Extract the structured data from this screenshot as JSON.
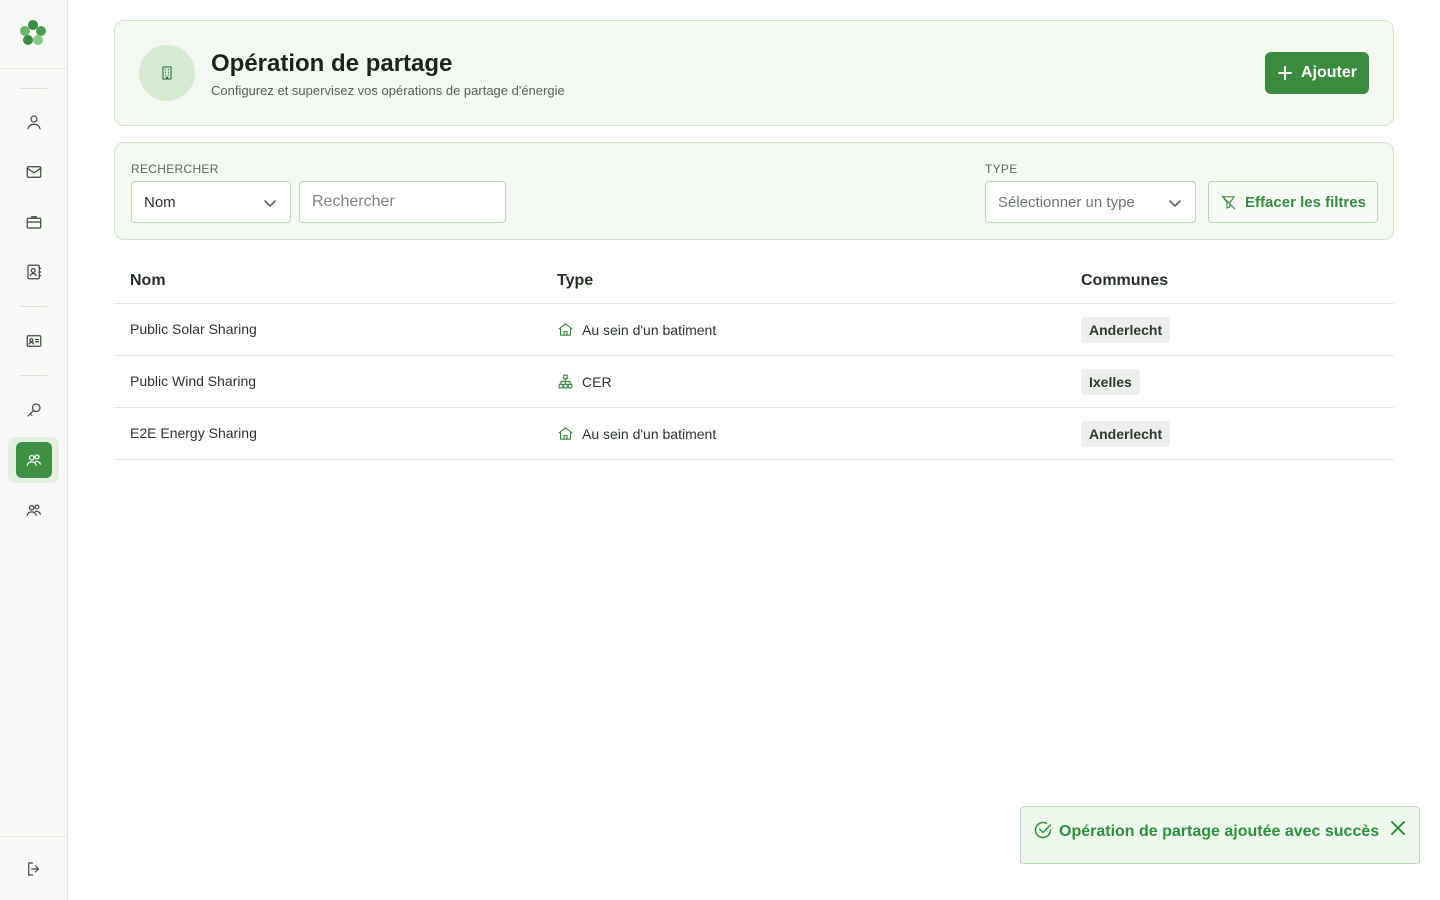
{
  "sidebar": {
    "logo": "leaf-flower-logo",
    "items": [
      {
        "name": "user-icon"
      },
      {
        "name": "mail-icon"
      },
      {
        "name": "briefcase-icon"
      },
      {
        "name": "contact-book-icon"
      },
      {
        "name": "id-card-icon"
      },
      {
        "name": "key-icon"
      },
      {
        "name": "users-sharing-icon",
        "active": true
      },
      {
        "name": "users-group-icon"
      }
    ],
    "logout": "logout-icon"
  },
  "header": {
    "icon": "building-icon",
    "title": "Opération de partage",
    "subtitle": "Configurez et supervisez vos opérations de partage d'énergie",
    "add_label": "Ajouter"
  },
  "filters": {
    "search_label": "RECHERCHER",
    "search_field_value": "Nom",
    "search_placeholder": "Rechercher",
    "type_label": "TYPE",
    "type_placeholder": "Sélectionner un type",
    "clear_label": "Effacer les filtres"
  },
  "table": {
    "columns": [
      "Nom",
      "Type",
      "Communes"
    ],
    "rows": [
      {
        "name": "Public Solar Sharing",
        "type": "Au sein d'un batiment",
        "type_icon": "home-icon",
        "commune": "Anderlecht"
      },
      {
        "name": "Public Wind Sharing",
        "type": "CER",
        "type_icon": "network-icon",
        "commune": "Ixelles"
      },
      {
        "name": "E2E Energy Sharing",
        "type": "Au sein d'un batiment",
        "type_icon": "home-icon",
        "commune": "Anderlecht"
      }
    ]
  },
  "toast": {
    "message": "Opération de partage ajoutée avec succès"
  },
  "colors": {
    "accent": "#3a8a3f",
    "card_bg": "#f3f9f1",
    "toast_text": "#2f8f3c"
  }
}
